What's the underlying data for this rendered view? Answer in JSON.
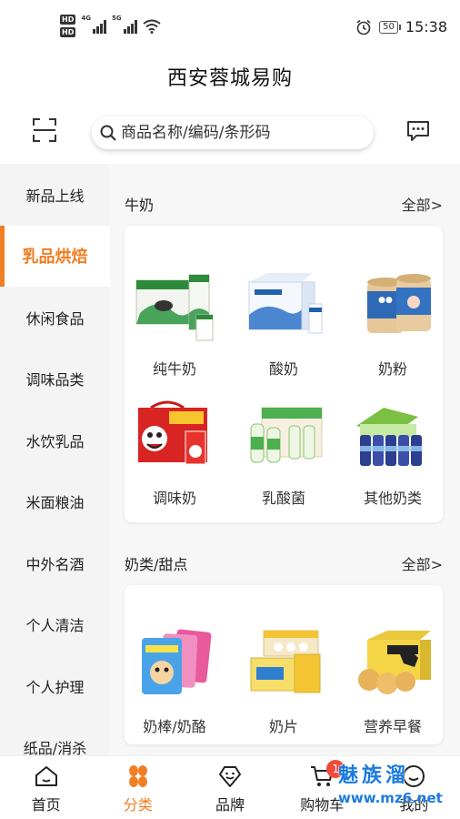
{
  "status_bar": {
    "hd1": "HD",
    "hd2": "HD",
    "net1": "4G",
    "net2": "5G",
    "battery": "50",
    "time": "15:38"
  },
  "header": {
    "title": "西安蓉城易购",
    "search_placeholder": "商品名称/编码/条形码"
  },
  "sidebar": {
    "items": [
      {
        "label": "新品上线"
      },
      {
        "label": "乳品烘焙"
      },
      {
        "label": "休闲食品"
      },
      {
        "label": "调味品类"
      },
      {
        "label": "水饮乳品"
      },
      {
        "label": "米面粮油"
      },
      {
        "label": "中外名酒"
      },
      {
        "label": "个人清洁"
      },
      {
        "label": "个人护理"
      },
      {
        "label": "纸品/消杀"
      }
    ],
    "active_index": 1
  },
  "sections": [
    {
      "title": "牛奶",
      "all_label": "全部>",
      "products": [
        {
          "label": "纯牛奶",
          "icon": "milk-box-image"
        },
        {
          "label": "酸奶",
          "icon": "yogurt-box-image"
        },
        {
          "label": "奶粉",
          "icon": "milk-powder-image"
        },
        {
          "label": "调味奶",
          "icon": "flavored-milk-image"
        },
        {
          "label": "乳酸菌",
          "icon": "lactobacillus-image"
        },
        {
          "label": "其他奶类",
          "icon": "other-milk-image"
        }
      ]
    },
    {
      "title": "奶类/甜点",
      "all_label": "全部>",
      "products": [
        {
          "label": "奶棒/奶酪",
          "icon": "cheese-stick-image"
        },
        {
          "label": "奶片",
          "icon": "milk-tablet-image"
        },
        {
          "label": "营养早餐",
          "icon": "breakfast-image"
        }
      ]
    }
  ],
  "bottom_nav": {
    "items": [
      {
        "label": "首页",
        "icon": "home-icon"
      },
      {
        "label": "分类",
        "icon": "category-icon"
      },
      {
        "label": "品牌",
        "icon": "brand-icon"
      },
      {
        "label": "购物车",
        "icon": "cart-icon",
        "badge": "1"
      },
      {
        "label": "我的",
        "icon": "user-icon"
      }
    ],
    "active_index": 1
  },
  "watermark": {
    "cn": "魅族溜",
    "url": "www.mz6.net"
  },
  "colors": {
    "accent": "#f07e23",
    "badge": "#ef4a3a",
    "sidebar_bg": "#f4f4f4"
  }
}
